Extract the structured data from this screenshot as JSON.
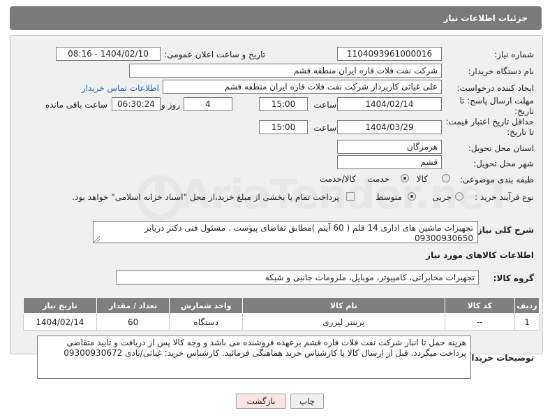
{
  "header": {
    "title": "جزئیات اطلاعات نیاز"
  },
  "need_number": {
    "label": "شماره نیاز:",
    "value": "1104093961000016"
  },
  "announce_datetime": {
    "label": "تاریخ و ساعت اعلان عمومی:",
    "value": "1404/02/10 - 08:16"
  },
  "buyer_org": {
    "label": "نام دستگاه خریدار:",
    "value": "شرکت نفت فلات قاره ایران منطقه قشم"
  },
  "requester": {
    "label": "ایجاد کننده درخواست:",
    "value": "علی غیاثی کاربرداز شرکت نفت فلات قاره ایران منطقه قشم",
    "contact_link": "اطلاعات تماس خریدار"
  },
  "reply_deadline": {
    "label": "مهلت ارسال پاسخ: تا تاریخ:",
    "date": "1404/02/14",
    "time_label": "ساعت",
    "time": "15:00",
    "days": "4",
    "days_label": "روز و",
    "remaining": "06:30:24",
    "remaining_label": "ساعت باقی مانده"
  },
  "price_validity": {
    "label": "حداقل تاریخ اعتبار قیمت: تا تاریخ:",
    "date": "1404/03/29",
    "time_label": "ساعت",
    "time": "15:00"
  },
  "delivery_province": {
    "label": "استان محل تحویل:",
    "value": "هرمزگان"
  },
  "delivery_city": {
    "label": "شهر محل تحویل:",
    "value": "قشم"
  },
  "category": {
    "label": "طبقه بندی موضوعی:",
    "options": [
      "کالا",
      "خدمت",
      "کالا/خدمت"
    ],
    "selected": "کالا"
  },
  "purchase_process": {
    "label": "نوع فرآیند خرید :",
    "options": [
      "جزیی",
      "متوسط"
    ],
    "selected": "متوسط",
    "note": "پرداخت تمام یا بخشی از مبلغ خرید،از محل \"اسناد خزانه اسلامی\" خواهد بود."
  },
  "description": {
    "label": "شرح کلی نیاز:",
    "value": "تجهیزات ماشین های اداری 14 قلم ( 60 آیتم )مطابق تقاضای پیوست . مسئول فنی دکتر دریابر 09300930650"
  },
  "goods_info": {
    "title": "اطلاعات کالاهای مورد نیاز"
  },
  "goods_group": {
    "label": "گروه کالا:",
    "value": "تجهیزات مخابراتی، کامپیوتر، موبایل، ملزومات جانبی و شبکه"
  },
  "table": {
    "headers": [
      "ردیف",
      "کد کالا",
      "نام کالا",
      "واحد شمارش",
      "تعداد / مقدار",
      "تاریخ نیاز"
    ],
    "rows": [
      {
        "row": "1",
        "code": "--",
        "name": "پرینتر لیزری",
        "unit": "دستگاه",
        "qty": "60",
        "date": "1404/02/14"
      }
    ]
  },
  "buyer_notes": {
    "label": "توضیحات خریدار:",
    "value": "هزینه حمل تا انبار شرکت نفت فلات قاره قشم برعهده فروشنده می باشد و وجه کالا پس از دریافت و تایید متقاضی پرداخت میگردد. قبل از ارسال کالا با کارشناس خرید هماهنگی فرمائید. کارشناس خرید: غیاثی/تادی 09300930672"
  },
  "buttons": {
    "print": "چاپ",
    "back": "بازگشت"
  },
  "watermark": {
    "text": "AriaTender.neT"
  },
  "colors": {
    "header_bg": "#7a7a7a",
    "panel_bg": "#f0f0f0",
    "link": "#2b63c6",
    "back_button_bg": "#fde3e3"
  }
}
